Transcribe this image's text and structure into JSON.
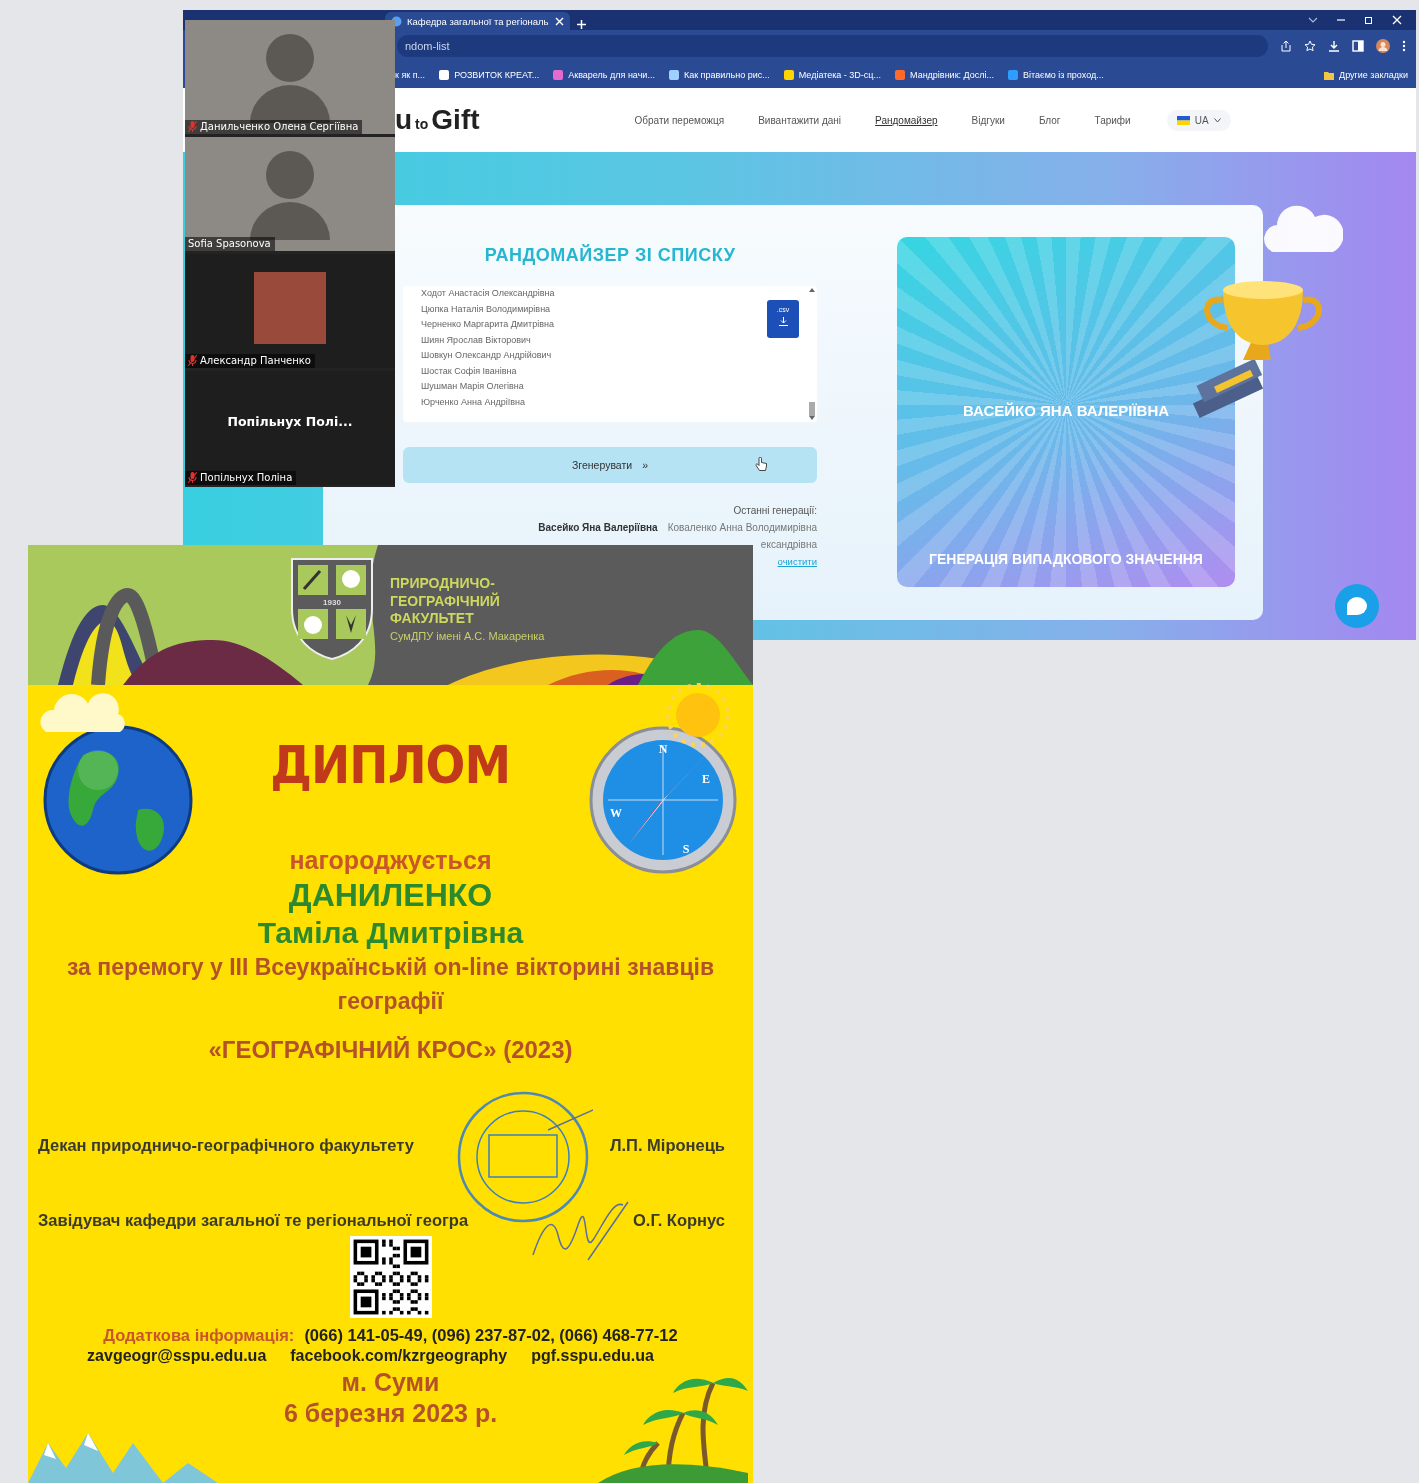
{
  "browser": {
    "tab_title": "Кафедра загальної та регіональ",
    "address": "ndom-list",
    "bookmarks": [
      "к як п...",
      "РОЗВИТОК КРЕАТ...",
      "Акварель для начи...",
      "Как правильно рис...",
      "Медіатека - 3D-сц...",
      "Мандрівник: Дослі...",
      "Вітаємо із проход..."
    ],
    "other_bookmarks": "Другие закладки"
  },
  "site": {
    "logo": [
      "u",
      "to",
      "Gift"
    ],
    "nav": [
      {
        "label": "Обрати переможця",
        "selected": false
      },
      {
        "label": "Вивантажити дані",
        "selected": false
      },
      {
        "label": "Рандомайзер",
        "selected": true
      },
      {
        "label": "Відгуки",
        "selected": false
      },
      {
        "label": "Блог",
        "selected": false
      },
      {
        "label": "Тарифи",
        "selected": false
      }
    ],
    "language": "UA",
    "randomizer": {
      "title": "РАНДОМАЙЗЕР ЗІ СПИСКУ",
      "entries": [
        "Ходот Анастасія Олександрівна",
        "Цюпка Наталія Володимирівна",
        "Черненко Маргарита Дмитрівна",
        "Шиян Ярослав Вікторович",
        "Шовкун Олександр Андрійович",
        "Шостак Софія Іванівна",
        "Шушман Марія Олегівна",
        "Юрченко Анна Андріївна"
      ],
      "file_badge": ".csv",
      "generate_button": "Згенерувати",
      "generate_arrow": "»",
      "recent_label": "Останні генерації:",
      "recent_rows": [
        {
          "names": [
            {
              "name": "Васейко Яна Валеріївна",
              "latest": true
            },
            {
              "name": "Коваленко Анна Володимирівна",
              "latest": false
            }
          ]
        },
        {
          "names": [
            {
              "name": "ександрівна",
              "latest": false
            }
          ]
        }
      ],
      "clear_link": "очистити"
    },
    "result": {
      "winner": "ВАСЕЙКО ЯНА ВАЛЕРІЇВНА",
      "caption": "ГЕНЕРАЦІЯ ВИПАДКОВОГО ЗНАЧЕННЯ"
    }
  },
  "video_call": {
    "participants": [
      {
        "kind": "video",
        "name": "Данильченко Олена Сергіївна",
        "muted": true
      },
      {
        "kind": "video",
        "name": "Sofia Spasonova",
        "muted": false
      },
      {
        "kind": "photo",
        "name": "Александр Панченко",
        "muted": true
      },
      {
        "kind": "name_only",
        "display_name": "Попільнух Полі...",
        "name": "Попільнух Поліна",
        "muted": true
      }
    ]
  },
  "diploma": {
    "crest_year": "1930",
    "faculty": [
      "ПРИРОДНИЧО-",
      "ГЕОГРАФІЧНИЙ",
      "ФАКУЛЬТЕТ"
    ],
    "university": "СумДПУ імені А.С. Макаренка",
    "title": "ДИПЛОМ",
    "awarded": "нагороджується",
    "surname": "ДАНИЛЕНКО",
    "given_names": "Таміла Дмитрівна",
    "reason": "за перемогу у  ІІІ Всеукраїнській on-line вікторині знавців географії",
    "event": "«ГЕОГРАФІЧНИЙ КРОС» (2023)",
    "compass_points": [
      "N",
      "E",
      "S",
      "W"
    ],
    "signatures": [
      {
        "role": "Декан природничо-географічного факультету",
        "name": "Л.П. Міронець"
      },
      {
        "role": "Завідувач кафедри загальної те регіональної геогра",
        "name": "О.Г. Корнус"
      }
    ],
    "contacts_label": "Додаткова інформація:",
    "phones": "(066) 141-05-49, (096) 237-87-02, (066) 468-77-12",
    "links": [
      "zavgeogr@sspu.edu.ua",
      "facebook.com/kzrgeography",
      "pgf.sspu.edu.ua"
    ],
    "city": "м. Суми",
    "date": "6 березня 2023 р."
  }
}
